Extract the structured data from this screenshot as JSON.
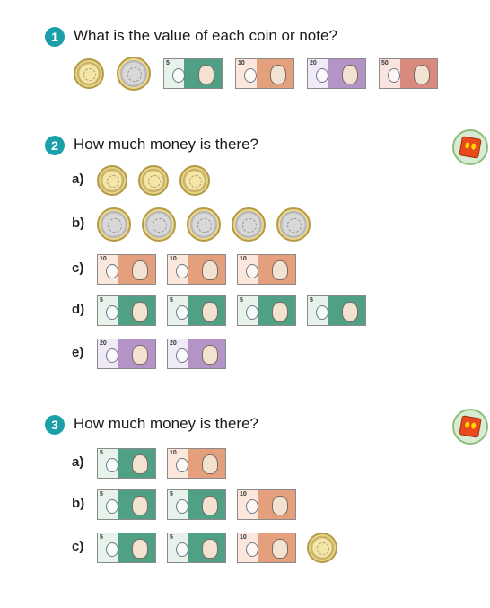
{
  "q1": {
    "number": "1",
    "text": "What is the value of each coin or note?",
    "items": [
      {
        "kind": "coin",
        "value": "£1",
        "icon": "one-pound-coin-icon"
      },
      {
        "kind": "coin",
        "value": "£2",
        "icon": "two-pound-coin-icon"
      },
      {
        "kind": "note",
        "value": "£5",
        "icon": "five-pound-note-icon"
      },
      {
        "kind": "note",
        "value": "£10",
        "icon": "ten-pound-note-icon"
      },
      {
        "kind": "note",
        "value": "£20",
        "icon": "twenty-pound-note-icon"
      },
      {
        "kind": "note",
        "value": "£50",
        "icon": "fifty-pound-note-icon"
      }
    ]
  },
  "q2": {
    "number": "2",
    "text": "How much money is there?",
    "badge_icon": "cube-icon",
    "parts": [
      {
        "label": "a)",
        "items": [
          "£1",
          "£1",
          "£1"
        ]
      },
      {
        "label": "b)",
        "items": [
          "£2",
          "£2",
          "£2",
          "£2",
          "£2"
        ]
      },
      {
        "label": "c)",
        "items": [
          "£10",
          "£10",
          "£10"
        ]
      },
      {
        "label": "d)",
        "items": [
          "£5",
          "£5",
          "£5",
          "£5"
        ]
      },
      {
        "label": "e)",
        "items": [
          "£20",
          "£20"
        ]
      }
    ]
  },
  "q3": {
    "number": "3",
    "text": "How much money is there?",
    "badge_icon": "cube-icon",
    "parts": [
      {
        "label": "a)",
        "items": [
          "£5",
          "£10"
        ]
      },
      {
        "label": "b)",
        "items": [
          "£5",
          "£5",
          "£10"
        ]
      },
      {
        "label": "c)",
        "items": [
          "£5",
          "£5",
          "£10",
          "£1"
        ]
      }
    ]
  }
}
